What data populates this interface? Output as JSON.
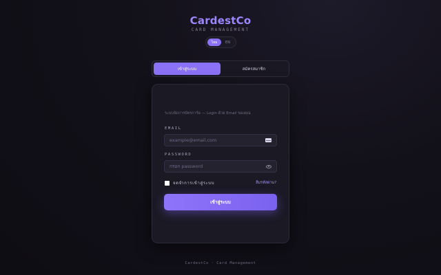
{
  "brand": {
    "name": "CardestCo",
    "subtitle": "CARD MANAGEMENT"
  },
  "language": {
    "options": [
      "ไทย",
      "EN"
    ],
    "selected": "ไทย"
  },
  "tabs": {
    "login": "เข้าสู่ระบบ",
    "register": "สมัครสมาชิก",
    "active": "login"
  },
  "form": {
    "intro": "ระบบจัดการบัตรการ์ด — Login ด้วย Email ของคุณ",
    "email": {
      "label": "EMAIL",
      "placeholder": "example@email.com",
      "value": "",
      "icon": "mail-icon"
    },
    "password": {
      "label": "PASSWORD",
      "placeholder": "กรอก password",
      "value": "",
      "icon": "eye-icon"
    },
    "remember_label": "จดจำการเข้าสู่ระบบ",
    "remember_checked": false,
    "forgot_label": "ลืมรหัสผ่าน?",
    "submit_label": "เข้าสู่ระบบ"
  },
  "footer": {
    "text": "CardestCo · Card Management"
  },
  "colors": {
    "accent": "#8b71f5",
    "background": "#121018",
    "card": "#1b1924"
  }
}
